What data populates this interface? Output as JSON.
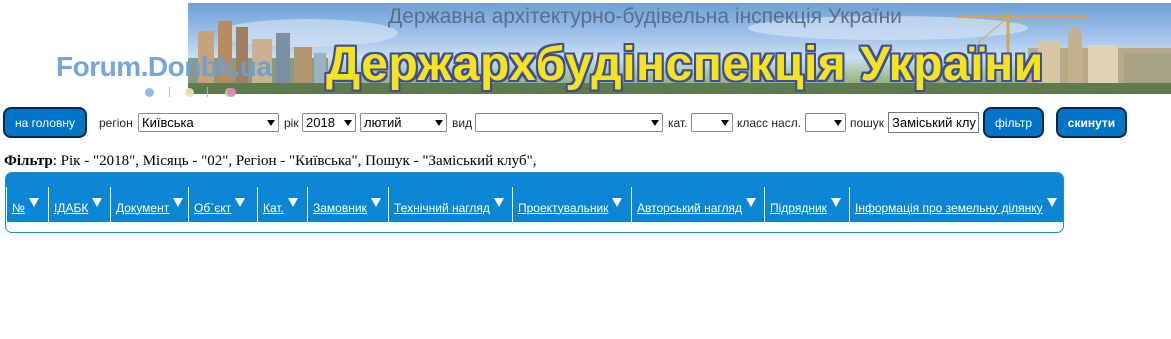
{
  "banner": {
    "subtitle": "Державна архітектурно-будівельна інспекція України",
    "title": "Держархбудінспекція України"
  },
  "forum_logo": {
    "text": "Forum.Donbk.ua"
  },
  "toolbar": {
    "home_label": "на головну",
    "region_label": "регіон",
    "region_value": "Київська",
    "year_label": "рік",
    "year_value": "2018",
    "month_value": "лютий",
    "type_label": "вид",
    "type_value": "",
    "cat_label": "кат.",
    "cat_value": "",
    "class_label": "класс насл.",
    "class_value": "",
    "search_label": "пошук",
    "search_value": "Заміський клу",
    "filter_label": "фільтр",
    "reset_label": "скинути"
  },
  "filter_summary": {
    "label": "Фільтр",
    "text": ": Рік - \"2018\", Місяць - \"02\", Регіон - \"Київська\", Пошук - \"Заміський клуб\","
  },
  "table": {
    "columns": [
      "№",
      "ІДАБК",
      "Документ",
      "Об`єкт",
      "Кат.",
      "Замовник",
      "Технічний нагляд",
      "Проектувальник",
      "Авторський нагляд",
      "Підрядник",
      "Інформація про земельну ділянку"
    ]
  },
  "colors": {
    "accent": "#0b86d4",
    "button": "#0074c8",
    "banner_title": "#f6e318"
  }
}
